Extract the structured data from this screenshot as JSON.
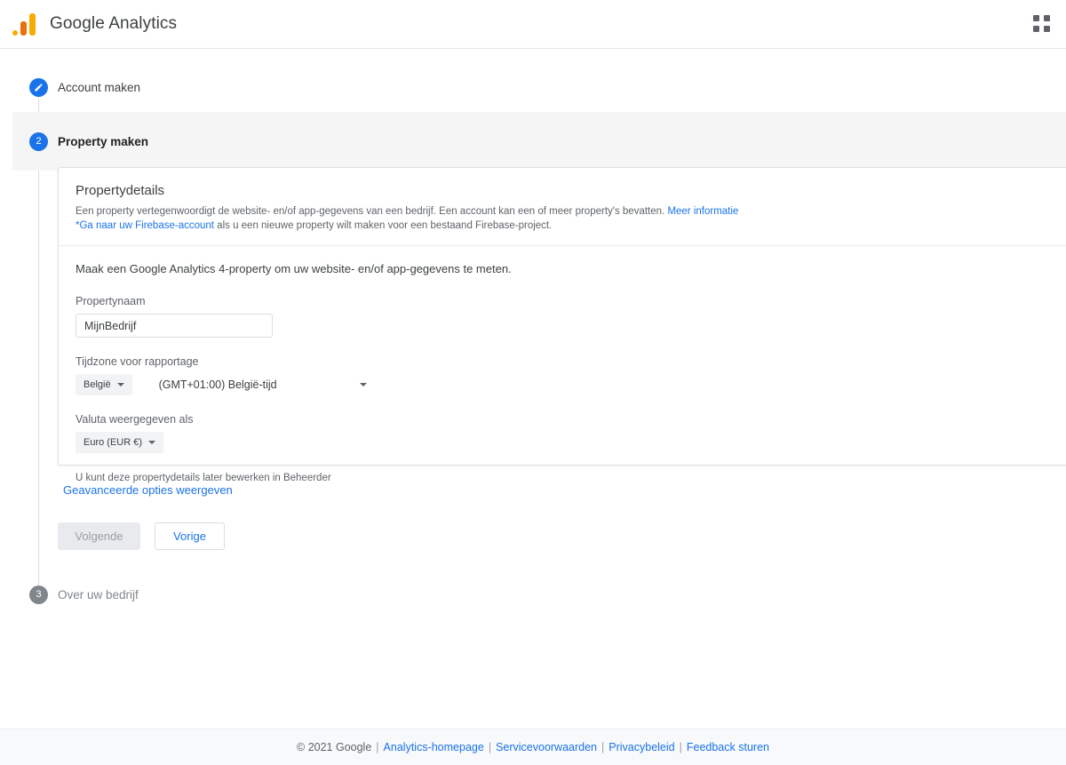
{
  "header": {
    "brand": "Google Analytics",
    "logo_icon": "analytics-bars-logo",
    "apps_icon": "apps-grid-icon",
    "logo_colors": {
      "dot": "#f9ab00",
      "mid_bar": "#e8710a",
      "tall_bar": "#f9ab00"
    }
  },
  "accent_colors": {
    "blue": "#1a73e8",
    "grey_step": "#80868b",
    "band_grey": "#f5f5f5",
    "border": "#e0e0e0"
  },
  "steps": [
    {
      "number": "1",
      "icon": "pencil-edit-icon",
      "label": "Account maken",
      "state": "completed"
    },
    {
      "number": "2",
      "icon": "step-number-2",
      "label": "Property maken",
      "state": "active"
    },
    {
      "number": "3",
      "icon": "step-number-3",
      "label": "Over uw bedrijf",
      "state": "upcoming"
    }
  ],
  "card": {
    "title": "Propertydetails",
    "description_part1": "Een property vertegenwoordigt de website- en/of app-gegevens van een bedrijf. Een account kan een of meer property's bevatten.",
    "description_link": "Meer informatie",
    "firebase_link": "*Ga naar uw Firebase-account",
    "firebase_rest": "als u een nieuwe property wilt maken voor een bestaand Firebase-project.",
    "body_intro": "Maak een Google Analytics 4-property om uw website- en/of app-gegevens te meten.",
    "property_name": {
      "label": "Propertynaam",
      "value": "MijnBedrijf",
      "placeholder": "Propertynaam"
    },
    "timezone": {
      "label": "Tijdzone voor rapportage",
      "country": "België",
      "value": "(GMT+01:00) België-tijd",
      "country_caret_icon": "chevron-down-icon",
      "value_caret_icon": "chevron-down-icon"
    },
    "currency": {
      "label": "Valuta weergegeven als",
      "value": "Euro (EUR €)",
      "caret_icon": "chevron-down-icon"
    },
    "hint": "U kunt deze propertydetails later bewerken in Beheerder"
  },
  "actions": {
    "advanced_options": "Geavanceerde opties weergeven",
    "next": "Volgende",
    "next_disabled": true,
    "previous": "Vorige"
  },
  "footer": {
    "copyright": "© 2021 Google",
    "links": [
      "Analytics-homepage",
      "Servicevoorwaarden",
      "Privacybeleid",
      "Feedback sturen"
    ],
    "separator": "|"
  }
}
